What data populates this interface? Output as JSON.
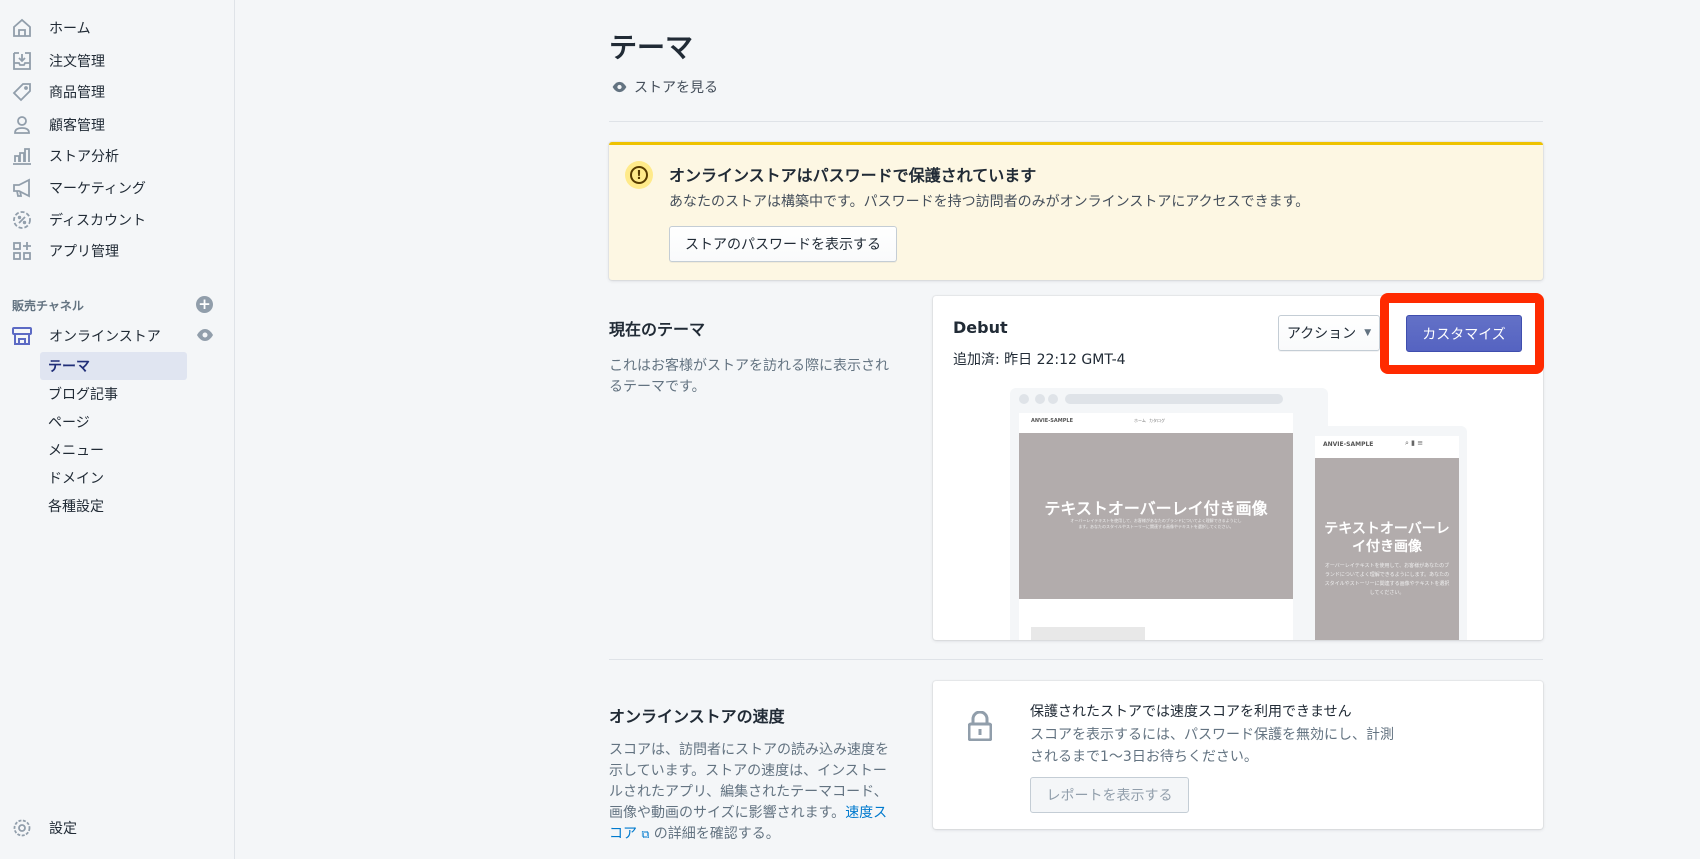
{
  "sidebar": {
    "items": [
      {
        "label": "ホーム",
        "icon": "home-icon"
      },
      {
        "label": "注文管理",
        "icon": "orders-icon"
      },
      {
        "label": "商品管理",
        "icon": "tag-icon"
      },
      {
        "label": "顧客管理",
        "icon": "customer-icon"
      },
      {
        "label": "ストア分析",
        "icon": "analytics-icon"
      },
      {
        "label": "マーケティング",
        "icon": "megaphone-icon"
      },
      {
        "label": "ディスカウント",
        "icon": "discount-icon"
      },
      {
        "label": "アプリ管理",
        "icon": "apps-icon"
      }
    ],
    "channels_heading": "販売チャネル",
    "online_store": "オンラインストア",
    "sub_items": [
      "テーマ",
      "ブログ記事",
      "ページ",
      "メニュー",
      "ドメイン",
      "各種設定"
    ],
    "settings": "設定"
  },
  "header": {
    "title": "テーマ",
    "view_store": "ストアを見る"
  },
  "banner": {
    "title": "オンラインストアはパスワードで保護されています",
    "body": "あなたのストアは構築中です。パスワードを持つ訪問者のみがオンラインストアにアクセスできます。",
    "button": "ストアのパスワードを表示する",
    "accent": "#eec200"
  },
  "current_theme": {
    "heading": "現在のテーマ",
    "description": "これはお客様がストアを訪れる際に表示されるテーマです。",
    "name": "Debut",
    "added": "追加済: 昨日 22:12 GMT-4",
    "actions_button": "アクション",
    "customize_button": "カスタマイズ",
    "highlight_color": "#ff2a00",
    "primary_color": "#5c6ac4",
    "preview": {
      "store_name": "ANVIE-SAMPLE",
      "nav": [
        "ホーム",
        "カタログ"
      ],
      "hero_title": "テキストオーバーレイ付き画像",
      "hero_text": "オーバーレイテキストを使用して、お客様があなたのブランドについてよく理解できるようにします。あなたのスタイルやストーリーに関連する画像やテキストを選択してください。"
    }
  },
  "speed": {
    "heading": "オンラインストアの速度",
    "description": "スコアは、訪問者にストアの読み込み速度を示しています。ストアの速度は、インストールされたアプリ、編集されたテーマコード、画像や動画のサイズに影響されます。",
    "link": "速度スコア",
    "description_tail": "の詳細を確認する。",
    "card_title": "保護されたストアでは速度スコアを利用できません",
    "card_body": "スコアを表示するには、パスワード保護を無効にし、計測されるまで1〜3日お待ちください。",
    "report_button": "レポートを表示する"
  }
}
